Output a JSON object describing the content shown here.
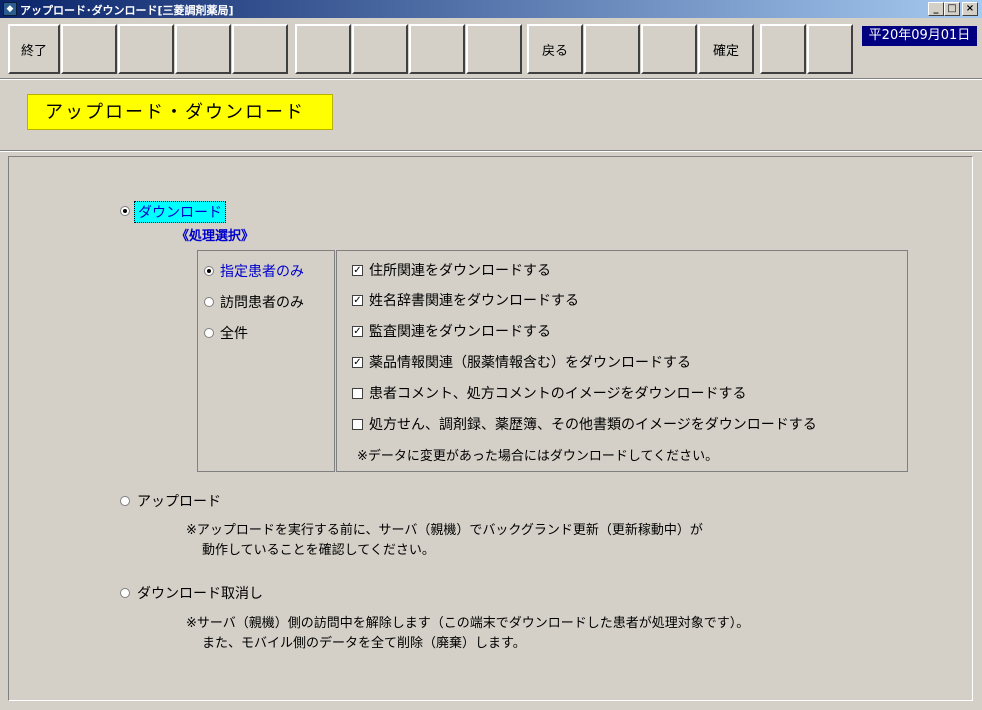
{
  "window": {
    "title": "アップロード･ダウンロード[三菱調剤薬局]",
    "minimize": "_",
    "maximize": "□",
    "close": "×"
  },
  "toolbar": {
    "buttons": [
      "終了",
      "",
      "",
      "",
      "",
      "",
      "",
      "",
      "",
      "戻る",
      "",
      "確定",
      "",
      ""
    ],
    "date": "平20年09月01日"
  },
  "page": {
    "title": "アップロード・ダウンロード"
  },
  "download": {
    "label": "ダウンロード",
    "selected": true,
    "process_heading": "《処理選択》",
    "scope_options": [
      {
        "label": "指定患者のみ",
        "selected": true
      },
      {
        "label": "訪問患者のみ",
        "selected": false
      },
      {
        "label": "全件",
        "selected": false
      }
    ],
    "items": [
      {
        "label": "住所関連をダウンロードする",
        "checked": true
      },
      {
        "label": "姓名辞書関連をダウンロードする",
        "checked": true
      },
      {
        "label": "監査関連をダウンロードする",
        "checked": true
      },
      {
        "label": "薬品情報関連（服薬情報含む）をダウンロードする",
        "checked": true
      },
      {
        "label": "患者コメント、処方コメントのイメージをダウンロードする",
        "checked": false
      },
      {
        "label": "処方せん、調剤録、薬歴簿、その他書類のイメージをダウンロードする",
        "checked": false
      }
    ],
    "note": "※データに変更があった場合にはダウンロードしてください。"
  },
  "upload": {
    "label": "アップロード",
    "selected": false,
    "note_line1": "※アップロードを実行する前に、サーバ（親機）でバックグランド更新（更新稼動中）が",
    "note_line2": "動作していることを確認してください。"
  },
  "cancel_download": {
    "label": "ダウンロード取消し",
    "selected": false,
    "note_line1": "※サーバ（親機）側の訪問中を解除します（この端末でダウンロードした患者が処理対象です）。",
    "note_line2": "また、モバイル側のデータを全て削除（廃棄）します。"
  },
  "colors": {
    "window_bg": "#d4d0c8",
    "title_gradient_start": "#0a246a",
    "title_gradient_end": "#a6caf0",
    "page_title_bg": "#ffff00",
    "selected_highlight": "#00ffff",
    "heading_blue": "#0000cc",
    "date_bg": "#000080"
  }
}
